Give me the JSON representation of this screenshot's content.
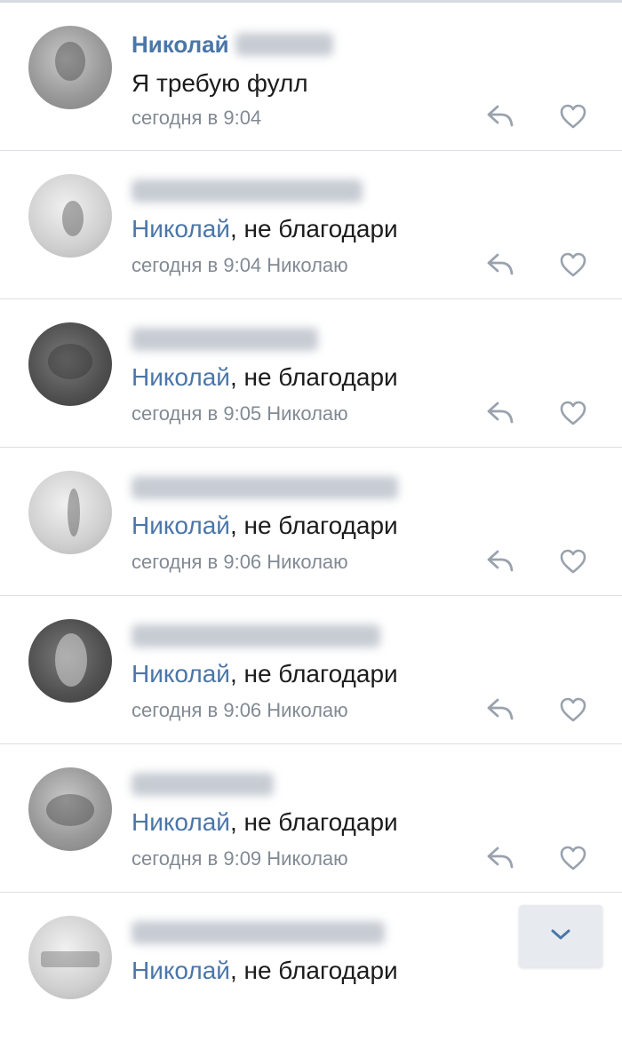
{
  "comments": [
    {
      "author": "Николай",
      "text": "Я требую фулл",
      "mention": "",
      "time": "сегодня в 9:04",
      "reply_to": ""
    },
    {
      "author": "",
      "mention": "Николай",
      "text": ", не благодари",
      "time": "сегодня в 9:04",
      "reply_to": "Николаю"
    },
    {
      "author": "",
      "mention": "Николай",
      "text": ", не благодари",
      "time": "сегодня в 9:05",
      "reply_to": "Николаю"
    },
    {
      "author": "",
      "mention": "Николай",
      "text": ", не благодари",
      "time": "сегодня в 9:06",
      "reply_to": "Николаю"
    },
    {
      "author": "",
      "mention": "Николай",
      "text": ", не благодари",
      "time": "сегодня в 9:06",
      "reply_to": "Николаю"
    },
    {
      "author": "",
      "mention": "Николай",
      "text": ", не благодари",
      "time": "сегодня в 9:09",
      "reply_to": "Николаю"
    },
    {
      "author": "",
      "mention": "Николай",
      "text": ", не благодари",
      "time": "",
      "reply_to": ""
    }
  ],
  "icons": {
    "reply": "reply-icon",
    "like": "heart-icon",
    "scroll_down": "chevron-down-icon"
  },
  "colors": {
    "link": "#4a76a8",
    "text": "#1c1c1c",
    "meta": "#828a94",
    "icon": "#99a2ad"
  }
}
